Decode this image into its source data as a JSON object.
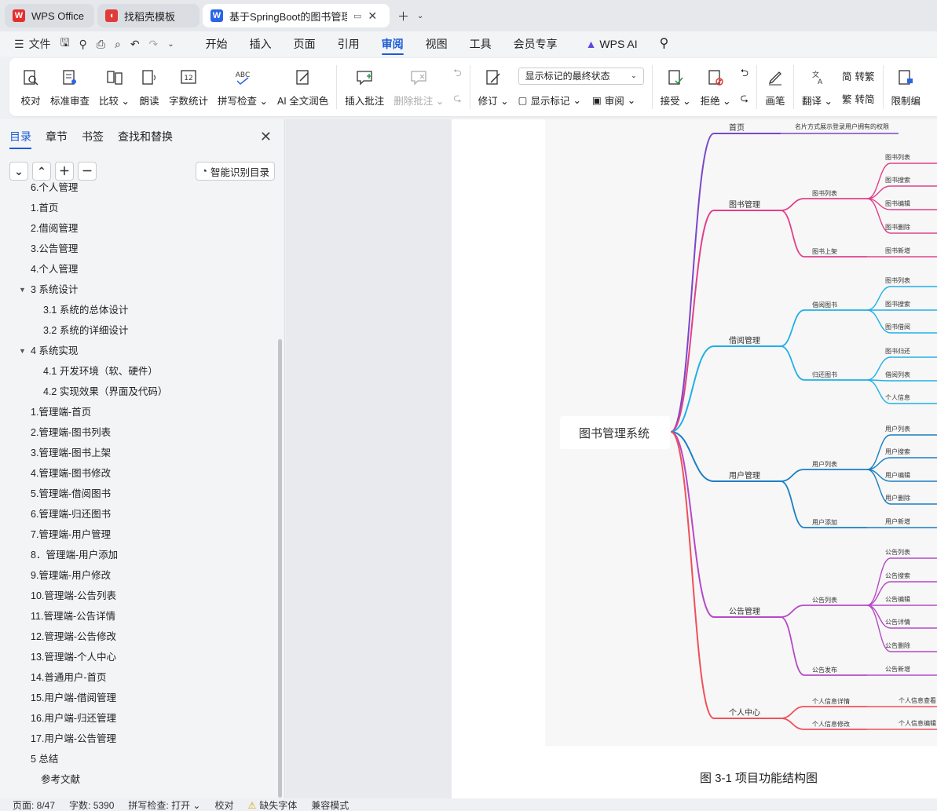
{
  "tabs": [
    {
      "label": "WPS Office",
      "icon": "wps-logo-icon",
      "color": "#e62e2e"
    },
    {
      "label": "找稻壳模板",
      "icon": "docer-icon",
      "color": "#e03a3a"
    },
    {
      "label": "基于SpringBoot的图书管理系",
      "icon": "word-doc-icon",
      "color": "#2a65e8"
    }
  ],
  "menubar": {
    "file_label": "文件",
    "items": [
      "开始",
      "插入",
      "页面",
      "引用",
      "审阅",
      "视图",
      "工具",
      "会员专享",
      "WPS AI"
    ],
    "active": "审阅"
  },
  "ribbon": {
    "proofread": "校对",
    "standard_review": "标准审查",
    "compare": "比较",
    "read_aloud": "朗读",
    "word_count": "字数统计",
    "spell_check": "拼写检查",
    "ai_polish": "AI 全文润色",
    "insert_comment": "插入批注",
    "delete_comment": "删除批注",
    "revise": "修订",
    "markup_select": "显示标记的最终状态",
    "show_markup": "显示标记",
    "review": "审阅",
    "accept": "接受",
    "reject": "拒绝",
    "pen": "画笔",
    "translate": "翻译",
    "to_traditional": "转繁",
    "to_simplified": "转简",
    "restrict_edit": "限制编"
  },
  "navpanel": {
    "tabs": [
      "目录",
      "章节",
      "书签",
      "查找和替换"
    ],
    "smart_button": "智能识别目录",
    "toc": [
      {
        "text": "6.个人管理",
        "indent": 1
      },
      {
        "text": "1.首页",
        "indent": 1
      },
      {
        "text": "2.借阅管理",
        "indent": 1
      },
      {
        "text": "3.公告管理",
        "indent": 1
      },
      {
        "text": "4.个人管理",
        "indent": 1
      },
      {
        "text": "3 系统设计",
        "indent": 1,
        "expand": true
      },
      {
        "text": "3.1 系统的总体设计",
        "indent": 2
      },
      {
        "text": "3.2  系统的详细设计",
        "indent": 2
      },
      {
        "text": "4 系统实现",
        "indent": 1,
        "expand": true
      },
      {
        "text": "4.1  开发环境（软、硬件）",
        "indent": 2
      },
      {
        "text": "4.2  实现效果（界面及代码）",
        "indent": 2
      },
      {
        "text": "1.管理端-首页",
        "indent": 1
      },
      {
        "text": "2.管理端-图书列表",
        "indent": 1
      },
      {
        "text": "3.管理端-图书上架",
        "indent": 1
      },
      {
        "text": "4.管理端-图书修改",
        "indent": 1
      },
      {
        "text": "5.管理端-借阅图书",
        "indent": 1
      },
      {
        "text": "6.管理端-归还图书",
        "indent": 1
      },
      {
        "text": "7.管理端-用户管理",
        "indent": 1
      },
      {
        "text": "8．管理端-用户添加",
        "indent": 1
      },
      {
        "text": "9.管理端-用户修改",
        "indent": 1
      },
      {
        "text": "10.管理端-公告列表",
        "indent": 1
      },
      {
        "text": "11.管理端-公告详情",
        "indent": 1
      },
      {
        "text": "12.管理端-公告修改",
        "indent": 1
      },
      {
        "text": "13.管理端-个人中心",
        "indent": 1
      },
      {
        "text": "14.普通用户-首页",
        "indent": 1
      },
      {
        "text": "15.用户端-借阅管理",
        "indent": 1
      },
      {
        "text": "16.用户端-归还管理",
        "indent": 1
      },
      {
        "text": "17.用户端-公告管理",
        "indent": 1
      },
      {
        "text": "5 总结",
        "indent": 1
      },
      {
        "text": "参考文献",
        "indent": 1.5
      }
    ]
  },
  "mindmap": {
    "root": "图书管理系统",
    "branches": [
      {
        "label": "首页",
        "color": "#7a47c9",
        "children": [
          {
            "label": "名片方式展示登录用户拥有的权限",
            "leaves": []
          }
        ]
      },
      {
        "label": "图书管理",
        "color": "#e0408a",
        "children": [
          {
            "label": "图书列表",
            "leaves": [
              "图书列表",
              "图书搜索",
              "图书编辑",
              "图书删除"
            ]
          },
          {
            "label": "图书上架",
            "leaves": [
              "图书新增"
            ]
          }
        ]
      },
      {
        "label": "借阅管理",
        "color": "#1fb0e8",
        "children": [
          {
            "label": "借阅图书",
            "leaves": [
              "图书列表",
              "图书搜索",
              "图书借阅"
            ]
          },
          {
            "label": "归还图书",
            "leaves": [
              "图书归还",
              "借阅列表",
              "个人信息"
            ]
          }
        ]
      },
      {
        "label": "用户管理",
        "color": "#1a7fc4",
        "children": [
          {
            "label": "用户列表",
            "leaves": [
              "用户列表",
              "用户搜索",
              "用户编辑",
              "用户删除"
            ]
          },
          {
            "label": "用户添加",
            "leaves": [
              "用户新增"
            ]
          }
        ]
      },
      {
        "label": "公告管理",
        "color": "#b648c8",
        "children": [
          {
            "label": "公告列表",
            "leaves": [
              "公告列表",
              "公告搜索",
              "公告编辑",
              "公告详情",
              "公告删除"
            ]
          },
          {
            "label": "公告发布",
            "leaves": [
              "公告新增"
            ]
          }
        ]
      },
      {
        "label": "个人中心",
        "color": "#f0505a",
        "children": [
          {
            "label": "个人信息详情",
            "leaves": [
              "个人信息查看"
            ]
          },
          {
            "label": "个人信息修改",
            "leaves": [
              "个人信息编辑"
            ]
          }
        ]
      }
    ]
  },
  "caption": "图 3-1 项目功能结构图",
  "statusbar": {
    "page": "页面: 8/47",
    "words": "字数: 5390",
    "spell": "拼写检查: 打开",
    "proof": "校对",
    "missing_font": "缺失字体",
    "compat": "兼容模式"
  }
}
